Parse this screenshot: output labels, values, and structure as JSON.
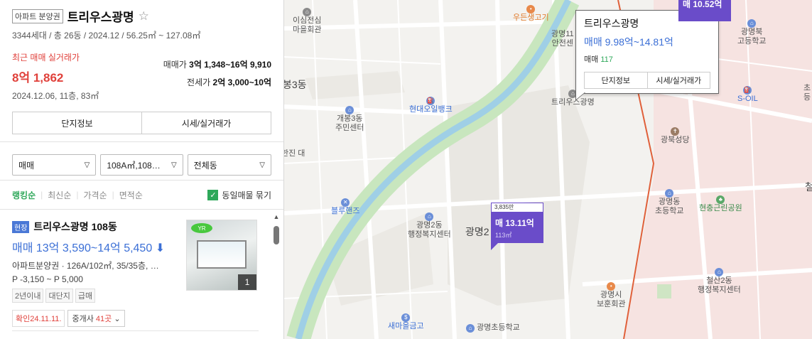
{
  "complex": {
    "tag": "아파트 분양권",
    "name": "트리우스광명",
    "star": "☆",
    "summary": "3344세대 / 총 26동 / 2024.12 / 56.25㎡ ~ 127.08㎡",
    "recent_label": "최근 매매 실거래가",
    "recent_price": "8억 1,862",
    "recent_meta": "2024.12.06, 11층, 83㎡",
    "sale_label": "매매가",
    "sale_range": "3억 1,348~16억 9,910",
    "jeonse_label": "전세가",
    "jeonse_range": "2억 3,000~10억",
    "btn_info": "단지정보",
    "btn_price": "시세/실거래가"
  },
  "filters": {
    "trade": "매매",
    "area": "108A㎡,108…",
    "dong": "전체동"
  },
  "sort": {
    "options": [
      "랭킹순",
      "최신순",
      "가격순",
      "면적순"
    ],
    "active": "랭킹순",
    "group_label": "동일매물 묶기"
  },
  "listing": {
    "badge": "현장",
    "title": "트리우스광명 108동",
    "price": "매매 13억 3,590~14억 5,450",
    "price_arrow": "⬇",
    "desc": "아파트분양권 · 126A/102㎡, 35/35층, …",
    "premium": "P -3,150 ~ P 5,000",
    "chips": [
      "2년이내",
      "대단지",
      "급매"
    ],
    "confirmed": "확인24.11.11.",
    "agent_label": "중개사",
    "agent_count": "41곳",
    "photo_logo": "YR",
    "photo_count": "1"
  },
  "map": {
    "labels": {
      "isim": "이심전심\n마을회관",
      "wooden": "우든생고기",
      "bong3": "봉3동",
      "gaebong3": "개봉3동\n주민센터",
      "hyundai": "현대오일뱅크",
      "hanjin": "한진\n대",
      "bluehands": "블루핸즈",
      "gm2center": "광명2동\n행정복지센터",
      "gm2": "광명2",
      "saemaul": "새마을금고",
      "gm2school": "광명초등학교",
      "trius": "트리우스광명",
      "safety": "광명11\n안전센",
      "gwangbuk_hs": "광명북\n고등학교",
      "soil": "S-OIL",
      "gwangbuk_church": "광북성당",
      "gm_es": "광명동\n초등학교",
      "park": "현충근린공원",
      "cheolsan2": "철산2동\n행정복지센터",
      "hall": "광명시\n보훈회관",
      "cho": "초등",
      "cheol": "철"
    },
    "popup": {
      "title": "트리우스광명",
      "price": "매매 9.98억~14.81억",
      "count_label": "매매",
      "count": "117",
      "btn_info": "단지정보",
      "btn_price": "시세/실거래가"
    },
    "marker": {
      "top": "3,835만",
      "value": "매 13.11억",
      "area": "113㎡"
    },
    "marker2": {
      "value": "매 10.52억"
    }
  }
}
